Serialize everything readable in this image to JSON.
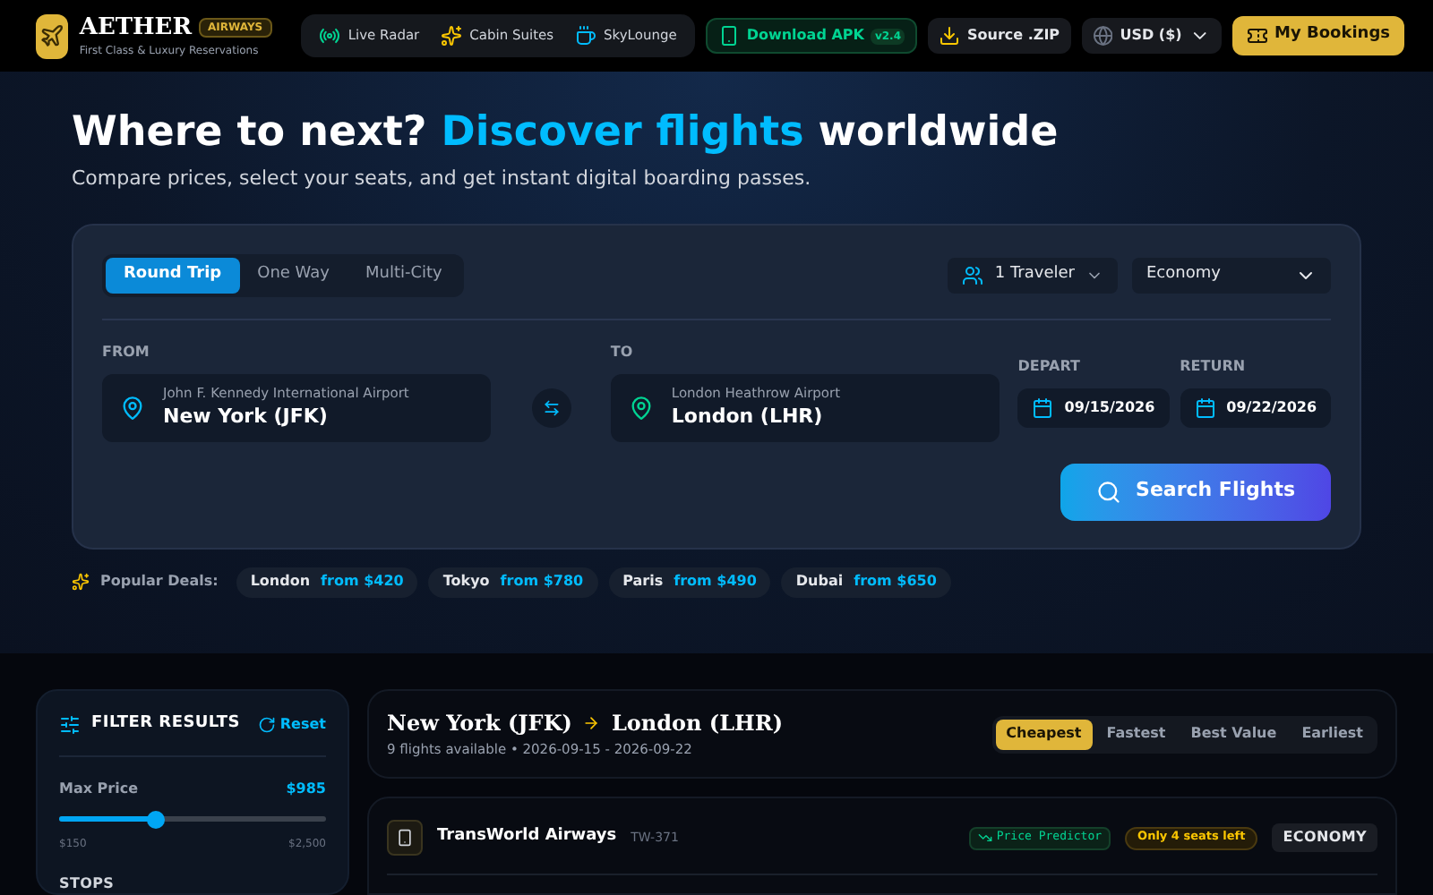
{
  "brand": {
    "name": "AETHER",
    "badge": "AIRWAYS",
    "tagline": "First Class & Luxury Reservations"
  },
  "nav": [
    {
      "label": "Live Radar",
      "kind": "radar"
    },
    {
      "label": "Cabin Suites",
      "kind": "suites"
    },
    {
      "label": "SkyLounge",
      "kind": "lounge"
    }
  ],
  "download": {
    "label": "Download APK",
    "version": "v2.4"
  },
  "source": {
    "label": "Source .ZIP"
  },
  "currency": {
    "value": "USD ($)"
  },
  "bookings": {
    "label": "My Bookings"
  },
  "hero": {
    "title": "Where to next?",
    "highlight": "Discover flights",
    "title_end": "worldwide",
    "subtitle": "Compare prices, select your seats, and get instant digital boarding passes."
  },
  "trip_types": [
    {
      "label": "Round Trip",
      "selected": true
    },
    {
      "label": "One Way",
      "selected": false
    },
    {
      "label": "Multi-City",
      "selected": false
    }
  ],
  "travelers": {
    "value": "1 Traveler"
  },
  "cabin": {
    "value": "Economy"
  },
  "from": {
    "label": "FROM",
    "airport": "John F. Kennedy International Airport",
    "city": "New York (JFK)"
  },
  "to": {
    "label": "TO",
    "airport": "London Heathrow Airport",
    "city": "London (LHR)"
  },
  "depart": {
    "label": "DEPART",
    "value": "09/15/2026"
  },
  "return": {
    "label": "RETURN",
    "value": "09/22/2026"
  },
  "search_button": "Search Flights",
  "deals": {
    "label": "Popular Deals:",
    "items": [
      {
        "city": "London",
        "price": "from $420"
      },
      {
        "city": "Tokyo",
        "price": "from $780"
      },
      {
        "city": "Paris",
        "price": "from $490"
      },
      {
        "city": "Dubai",
        "price": "from $650"
      }
    ]
  },
  "filters": {
    "title": "FILTER RESULTS",
    "reset": "Reset",
    "max_price": {
      "label": "Max Price",
      "value": "$985",
      "level": 0.36,
      "min": "$150",
      "max": "$2,500"
    },
    "stops_label": "STOPS"
  },
  "results": {
    "from": "New York (JFK)",
    "to": "London (LHR)",
    "summary": "9 flights available • 2026-09-15 - 2026-09-22",
    "sorts": [
      {
        "label": "Cheapest",
        "selected": true
      },
      {
        "label": "Fastest",
        "selected": false
      },
      {
        "label": "Best Value",
        "selected": false
      },
      {
        "label": "Earliest",
        "selected": false
      }
    ]
  },
  "flight": {
    "airline": "TransWorld Airways",
    "code": "TW-371",
    "predictor": "Price Predictor",
    "seats": "Only 4 seats left",
    "cabin": "ECONOMY"
  }
}
